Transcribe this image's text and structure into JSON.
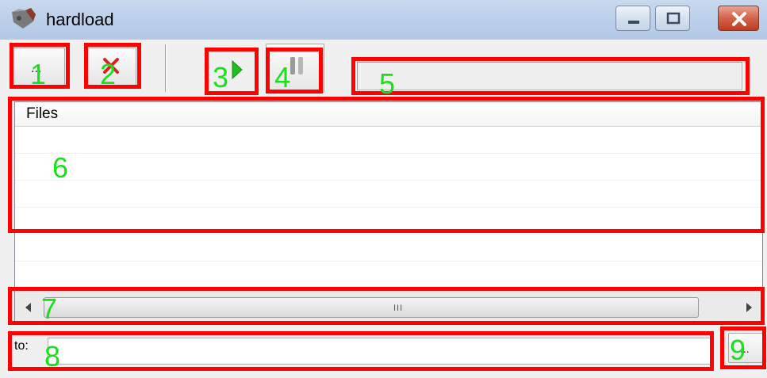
{
  "window": {
    "title": "hardload"
  },
  "toolbar": {
    "add_button": "add-files",
    "remove_button": "remove-files",
    "start_button": "start",
    "pause_button": "pause",
    "progress_value": 0
  },
  "file_list": {
    "column_header": "Files",
    "rows": []
  },
  "scrollbar": {
    "grip": "III"
  },
  "destination": {
    "label": "to:",
    "value": "",
    "browse_icon": "ellipsis-icon"
  },
  "annotations": [
    "1",
    "2",
    "3",
    "4",
    "5",
    "6",
    "7",
    "8",
    "9"
  ],
  "colors": {
    "annotation_box": "#ff0000",
    "annotation_number": "#19e019",
    "start_arrow": "#1fbf1f",
    "remove_x": "#e02020"
  }
}
